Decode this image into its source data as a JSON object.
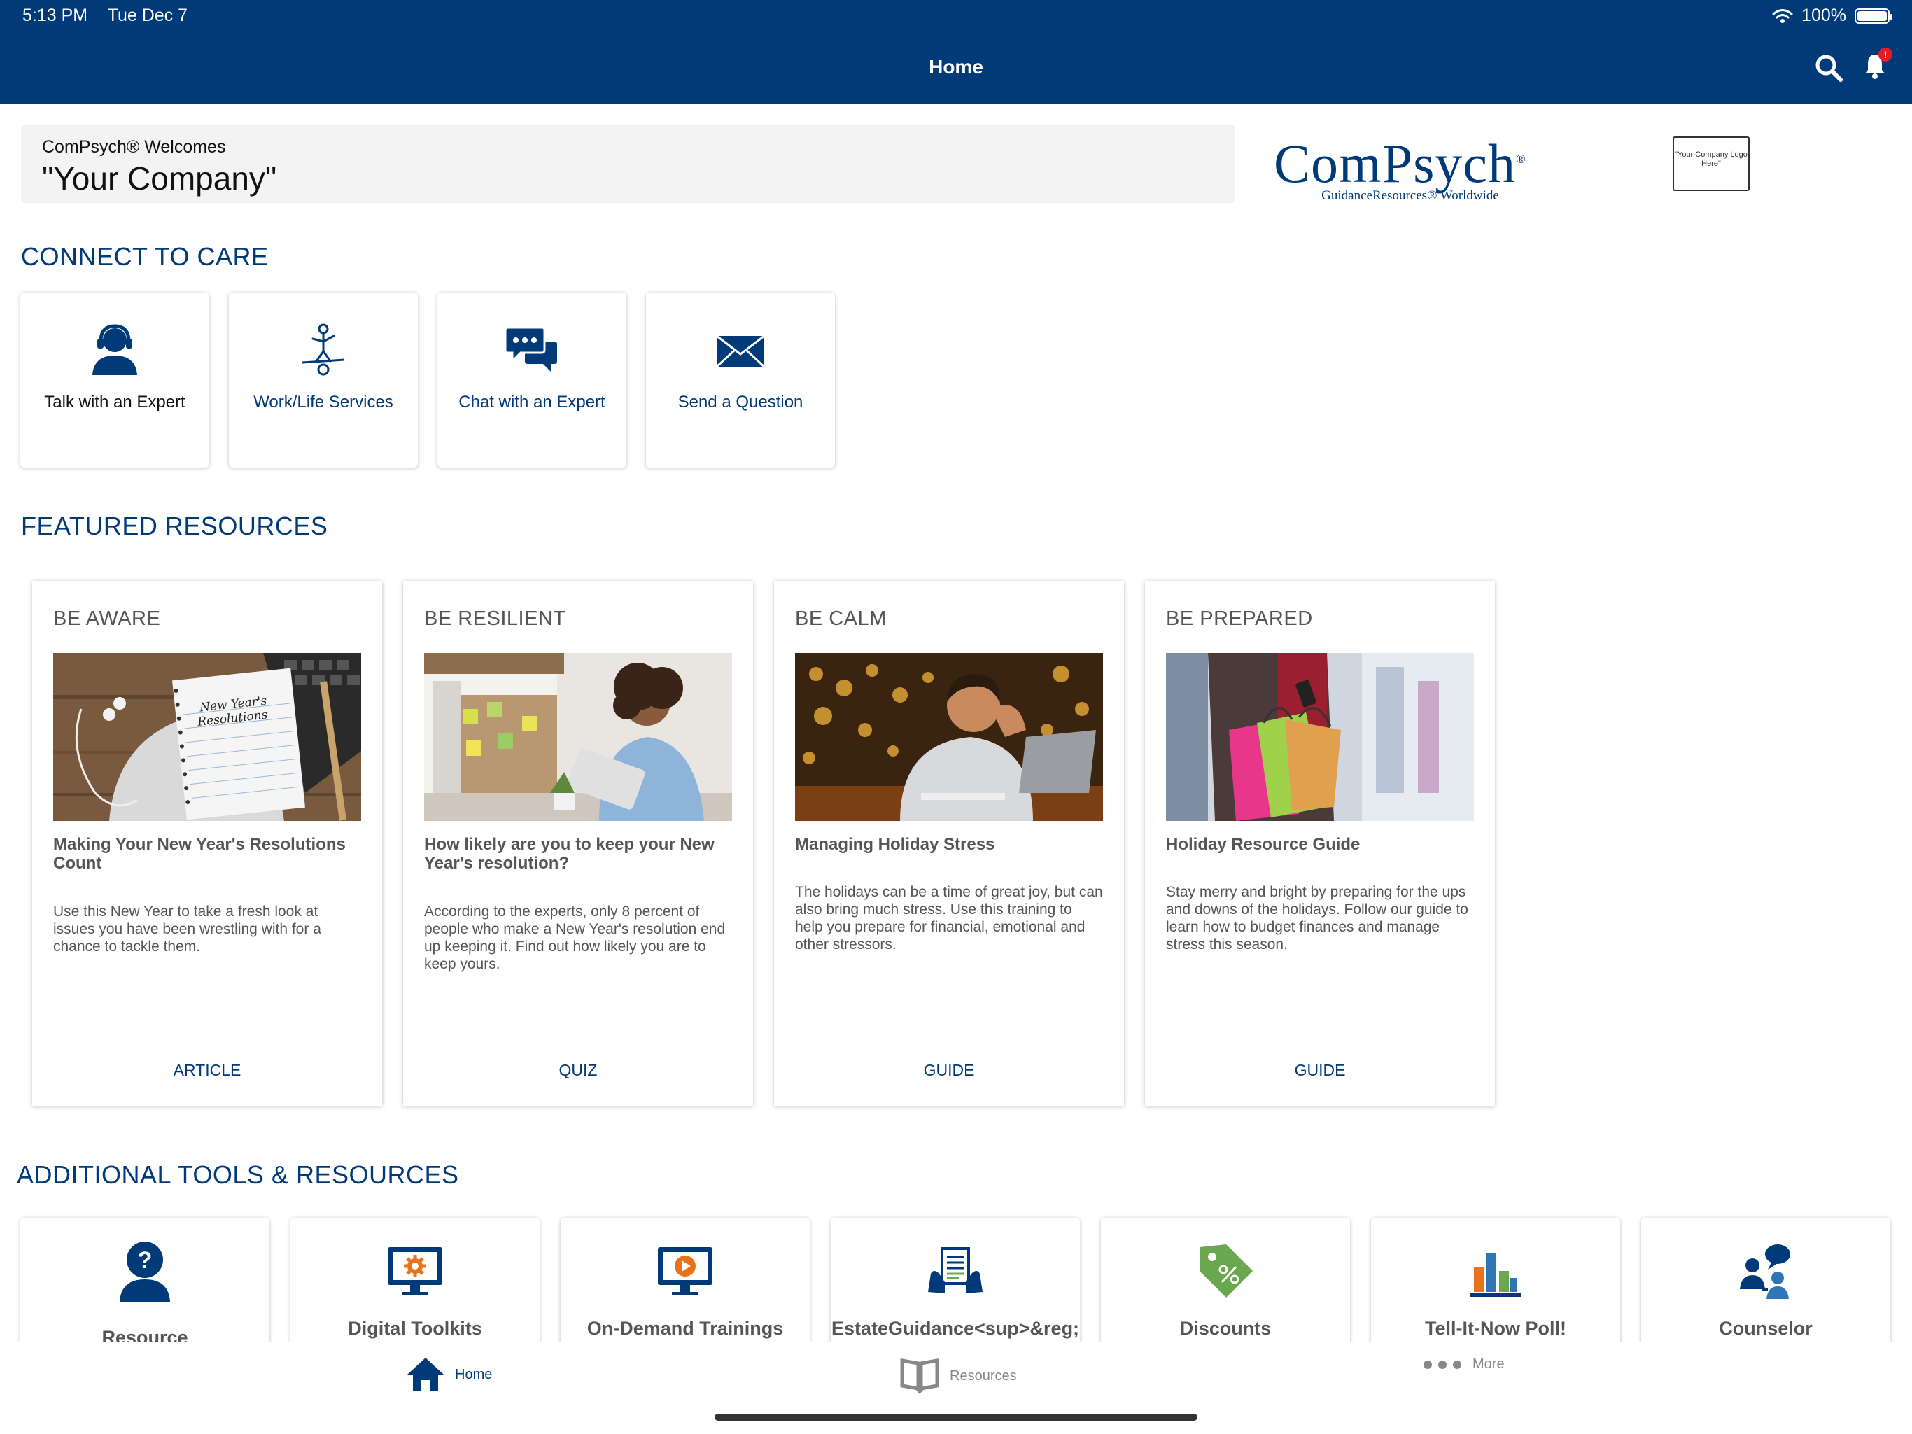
{
  "status_bar": {
    "time": "5:13 PM",
    "date": "Tue Dec 7",
    "battery": "100%"
  },
  "nav": {
    "title": "Home",
    "notification_badge": "!"
  },
  "welcome": {
    "pre": "ComPsych® Welcomes",
    "company": "\"Your Company\""
  },
  "brand": {
    "logo_main": "ComPsych",
    "logo_reg": "®",
    "logo_sub": "GuidanceResources® Worldwide",
    "client_logo": "\"Your Company Logo Here\""
  },
  "connect": {
    "title": "CONNECT TO CARE",
    "cards": [
      {
        "label": "Talk with an Expert",
        "icon": "headset-person-icon"
      },
      {
        "label": "Work/Life Services",
        "icon": "balance-figure-icon"
      },
      {
        "label": "Chat with an Expert",
        "icon": "chat-bubbles-icon"
      },
      {
        "label": "Send a Question",
        "icon": "envelope-icon"
      }
    ]
  },
  "featured": {
    "title": "FEATURED RESOURCES",
    "cards": [
      {
        "category": "BE AWARE",
        "title": "Making Your New Year's Resolutions Count",
        "description": "Use this New Year to take a fresh look at issues you have been wrestling with for a chance to tackle them.",
        "type": "ARTICLE",
        "image_text_1": "New Year's",
        "image_text_2": "Resolutions"
      },
      {
        "category": "BE RESILIENT",
        "title": "How likely are you to keep your New Year's resolution?",
        "description": "According to the experts, only 8 percent of people who make a New Year's resolution end up keeping it. Find out how likely you are to keep yours.",
        "type": "QUIZ"
      },
      {
        "category": "BE CALM",
        "title": "Managing Holiday Stress",
        "description": "The holidays can be a time of great joy, but can also bring much stress. Use this training to help you prepare for financial, emotional and other stressors.",
        "type": "GUIDE"
      },
      {
        "category": "BE PREPARED",
        "title": "Holiday Resource Guide",
        "description": "Stay merry and bright by preparing for the ups and downs of the holidays. Follow our guide to learn how to budget finances and manage stress this season.",
        "type": "GUIDE"
      }
    ]
  },
  "tools": {
    "title": "ADDITIONAL TOOLS & RESOURCES",
    "cards": [
      {
        "label": "Resource",
        "icon": "question-person-icon"
      },
      {
        "label": "Digital Toolkits",
        "icon": "monitor-gear-icon"
      },
      {
        "label": "On-Demand Trainings",
        "icon": "monitor-play-icon"
      },
      {
        "label": "EstateGuidance<sup>&reg;",
        "icon": "document-hands-icon"
      },
      {
        "label": "Discounts",
        "icon": "price-tag-icon"
      },
      {
        "label": "Tell-It-Now Poll!",
        "icon": "bar-chart-icon"
      },
      {
        "label": "Counselor",
        "icon": "counselor-people-icon"
      }
    ]
  },
  "tabbar": {
    "home": "Home",
    "resources": "Resources",
    "more": "More"
  },
  "colors": {
    "primary": "#003a78",
    "accent_green": "#6aa84f",
    "accent_orange": "#e8731a",
    "badge_red": "#e21b2b"
  }
}
